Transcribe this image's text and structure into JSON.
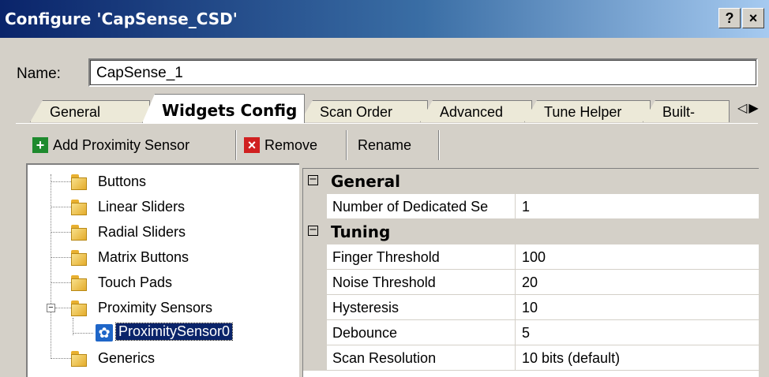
{
  "window": {
    "title": "Configure 'CapSense_CSD'",
    "help_label": "?",
    "close_label": "×"
  },
  "name_field": {
    "label": "Name:",
    "value": "CapSense_1"
  },
  "tabs": [
    {
      "label": "General"
    },
    {
      "label": "Widgets Config"
    },
    {
      "label": "Scan Order"
    },
    {
      "label": "Advanced"
    },
    {
      "label": "Tune Helper"
    },
    {
      "label": "Built-"
    }
  ],
  "tab_scroll": {
    "left": "◁",
    "right": "▶"
  },
  "toolbar": {
    "add_label": "Add Proximity Sensor",
    "remove_label": "Remove",
    "rename_label": "Rename"
  },
  "tree": {
    "items": [
      {
        "label": "Buttons"
      },
      {
        "label": "Linear Sliders"
      },
      {
        "label": "Radial Sliders"
      },
      {
        "label": "Matrix Buttons"
      },
      {
        "label": "Touch Pads"
      },
      {
        "label": "Proximity Sensors"
      },
      {
        "label": "ProximitySensor0"
      },
      {
        "label": "Generics"
      }
    ]
  },
  "properties": {
    "general": {
      "title": "General",
      "rows": [
        {
          "name": "Number of Dedicated Se",
          "value": "1"
        }
      ]
    },
    "tuning": {
      "title": "Tuning",
      "rows": [
        {
          "name": "Finger Threshold",
          "value": "100"
        },
        {
          "name": "Noise Threshold",
          "value": "20"
        },
        {
          "name": "Hysteresis",
          "value": "10"
        },
        {
          "name": "Debounce",
          "value": "5"
        },
        {
          "name": "Scan Resolution",
          "value": "10 bits (default)"
        }
      ]
    }
  },
  "colors": {
    "title_start": "#0a246a",
    "title_end": "#a6caf0",
    "selection": "#0a246a",
    "add_icon": "#1e8a2e",
    "remove_icon": "#d02020"
  },
  "icons": [
    "help-icon",
    "close-icon",
    "add-icon",
    "remove-icon",
    "folder-icon",
    "gear-icon"
  ]
}
